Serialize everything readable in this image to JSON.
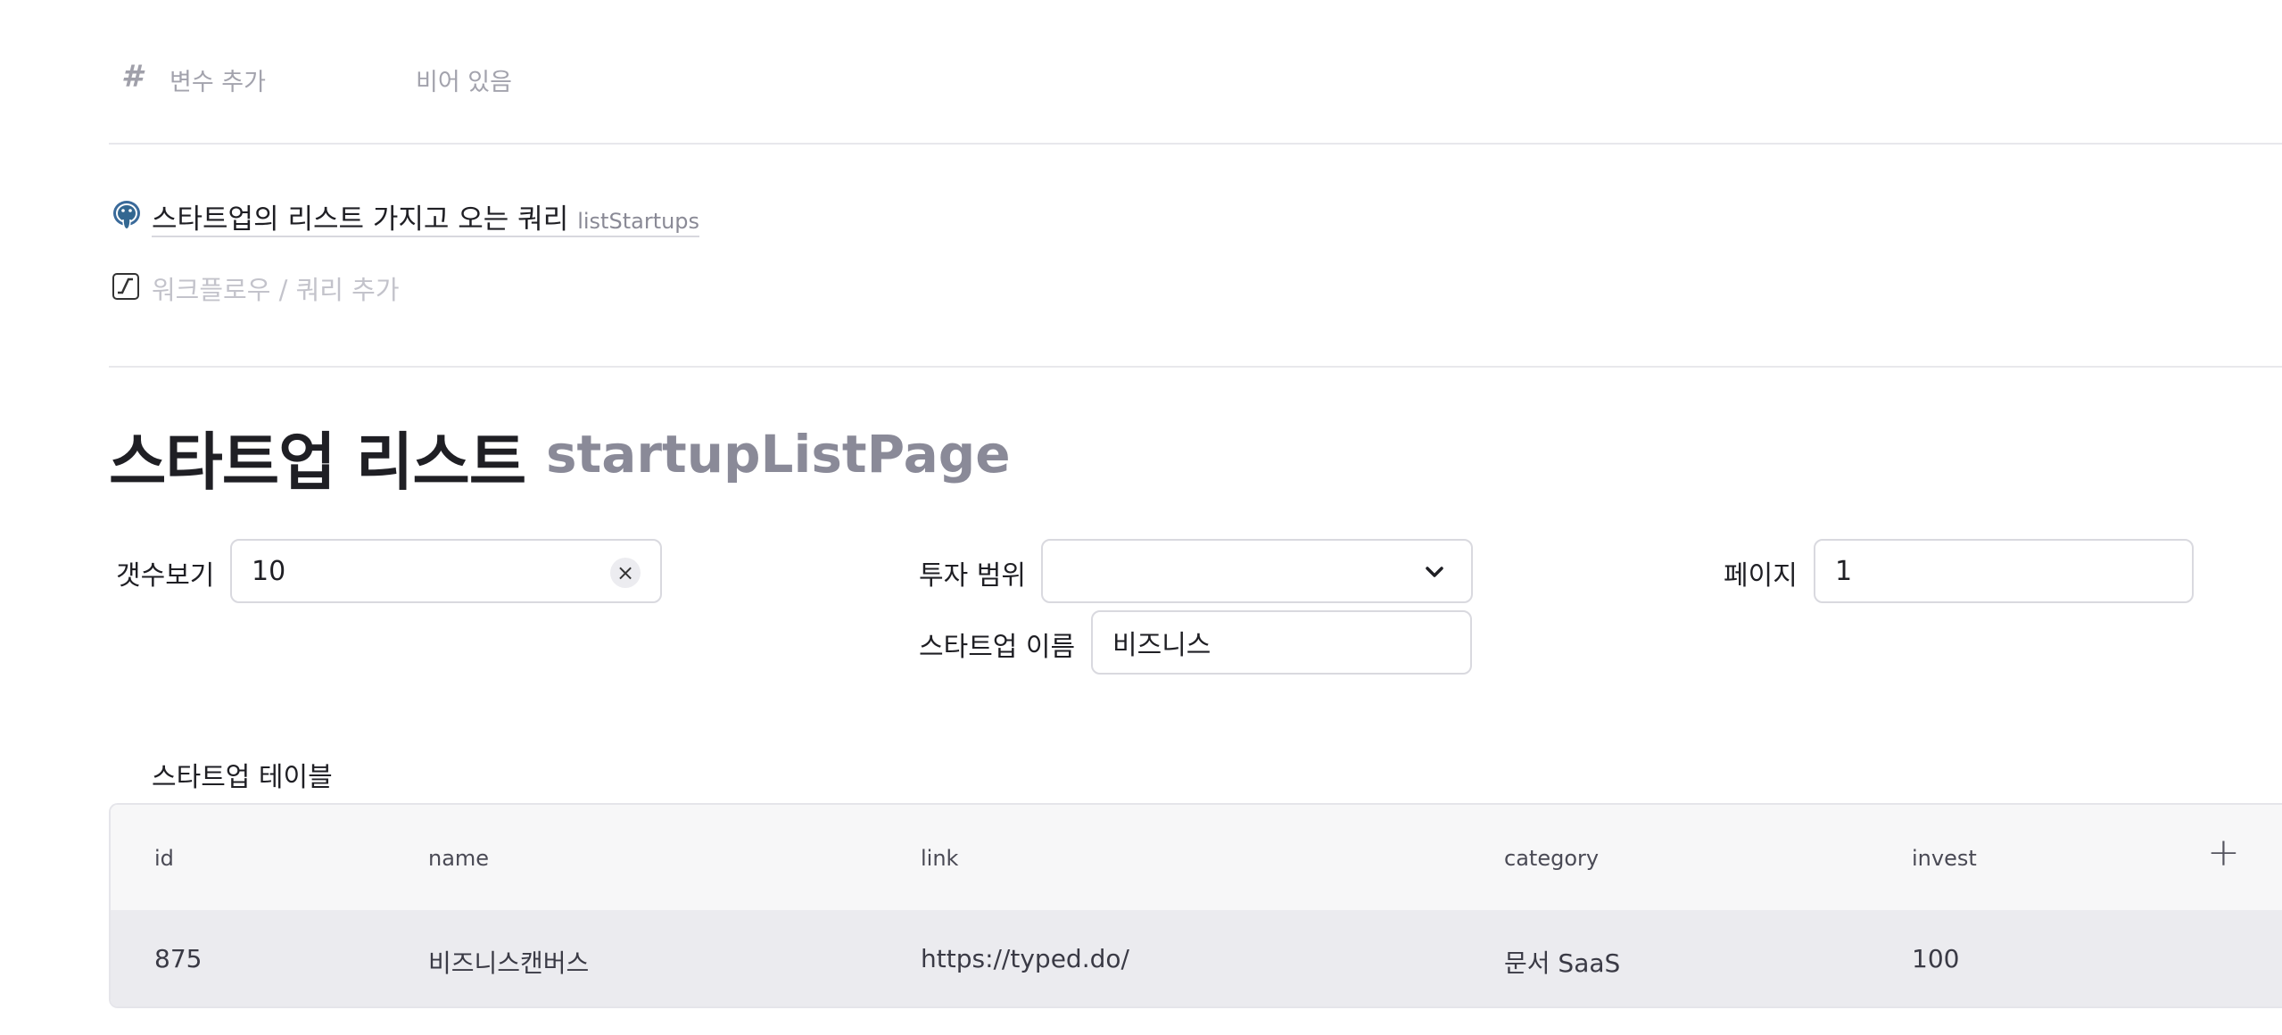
{
  "variables": {
    "icon": "#",
    "add_label": "변수 추가",
    "value_text": "비어 있음"
  },
  "query": {
    "icon": "postgres-elephant-icon",
    "title": "스타트업의 리스트 가지고 오는 쿼리",
    "id": "listStartups"
  },
  "workflow": {
    "icon": "workflow-icon",
    "add_label": "워크플로우 / 쿼리 추가"
  },
  "page": {
    "title": "스타트업 리스트",
    "id": "startupListPage"
  },
  "filters": {
    "count": {
      "label": "갯수보기",
      "value": "10",
      "clear_glyph": "×"
    },
    "invest_range": {
      "label": "투자 범위",
      "value": ""
    },
    "page": {
      "label": "페이지",
      "value": "1"
    },
    "startup_name": {
      "label": "스타트업 이름",
      "value": "비즈니스"
    }
  },
  "table": {
    "label": "스타트업 테이블",
    "columns": [
      "id",
      "name",
      "link",
      "category",
      "invest"
    ],
    "add_column_glyph": "+",
    "rows": [
      {
        "id": "875",
        "name": "비즈니스캔버스",
        "link": "https://typed.do/",
        "category": "문서 SaaS",
        "invest": "100"
      }
    ]
  },
  "colors": {
    "muted_text": "#a3a3ad",
    "id_gray": "#8a8a98",
    "header_bg": "#f7f7f8",
    "row_bg": "#ebebef",
    "border": "#d9d9df"
  }
}
